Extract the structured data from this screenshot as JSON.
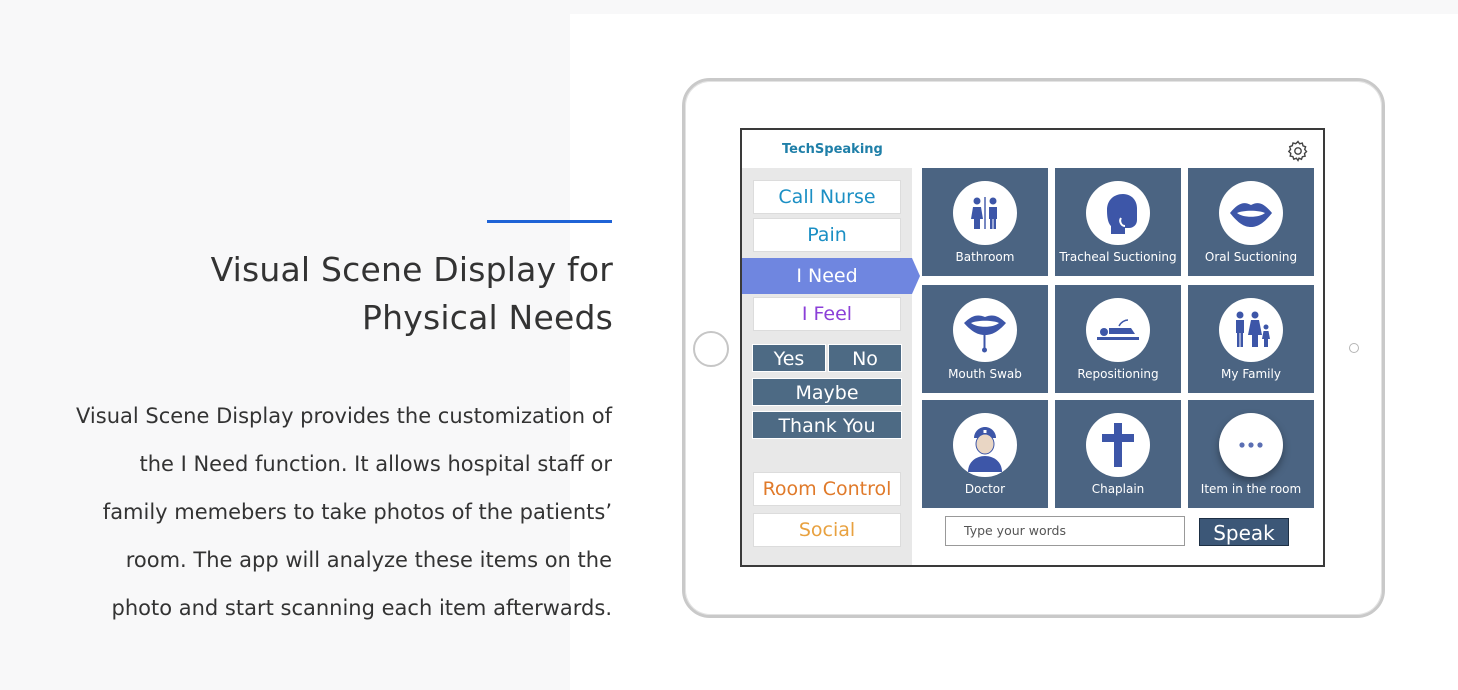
{
  "left": {
    "title_lines": [
      "Visual Scene Display for",
      "Physical Needs"
    ],
    "description_lines": [
      "Visual Scene Display provides the customization of",
      "the I Need function. It allows hospital staff or",
      "family memebers to take photos of the patients’",
      "room. The app will analyze these items on the",
      "photo and start scanning each item afterwards."
    ],
    "accent_color": "#1f63d6"
  },
  "app": {
    "brand": "TechSpeaking",
    "settings_icon": "gear-icon",
    "sidebar": {
      "call_nurse": "Call Nurse",
      "pain": "Pain",
      "i_need": "I Need",
      "i_feel": "I Feel",
      "yes": "Yes",
      "no": "No",
      "maybe": "Maybe",
      "thank_you": "Thank You",
      "room_control": "Room Control",
      "social": "Social"
    },
    "tiles": [
      {
        "label": "Bathroom",
        "icon": "restroom-icon"
      },
      {
        "label": "Tracheal Suctioning",
        "icon": "head-profile-icon"
      },
      {
        "label": "Oral Suctioning",
        "icon": "mouth-icon"
      },
      {
        "label": "Mouth Swab",
        "icon": "mouth-swab-icon"
      },
      {
        "label": "Repositioning",
        "icon": "lying-person-icon"
      },
      {
        "label": "My Family",
        "icon": "family-icon"
      },
      {
        "label": "Doctor",
        "icon": "doctor-icon"
      },
      {
        "label": "Chaplain",
        "icon": "cross-icon"
      },
      {
        "label": "Item in the room",
        "icon": "more-icon"
      }
    ],
    "input_placeholder": "Type your words",
    "speak": "Speak",
    "colors": {
      "tile": "#4b6482",
      "active": "#6f86e0",
      "dark_button": "#4d6a84"
    }
  }
}
